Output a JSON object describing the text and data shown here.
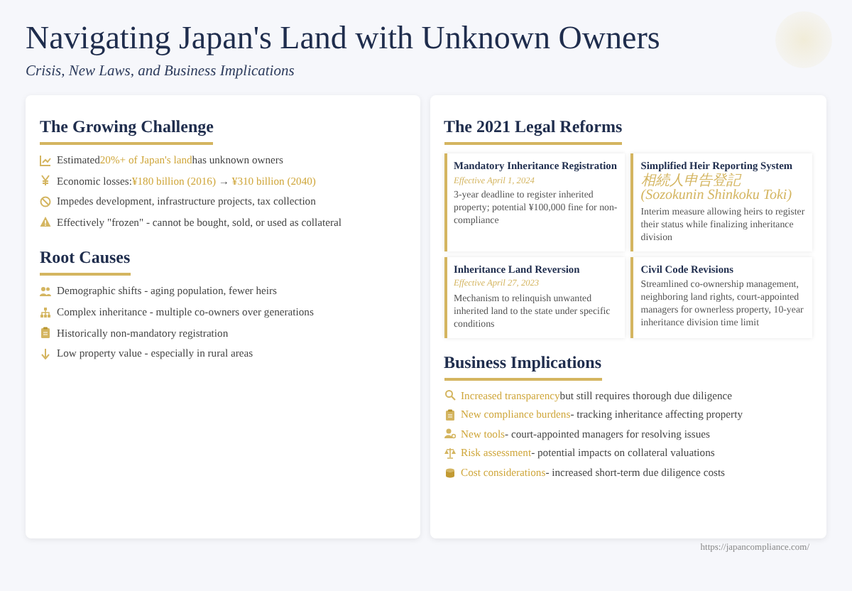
{
  "title": "Navigating Japan's Land with Unknown Owners",
  "subtitle": "Crisis, New Laws, and Business Implications",
  "left_panel": {
    "sections": [
      {
        "heading": "The Growing Challenge",
        "items": [
          {
            "segments": [
              {
                "kind": "plain",
                "text": "Estimated"
              },
              {
                "kind": "highlight",
                "text": "20%+ of Japan's land"
              },
              {
                "kind": "plain",
                "text": "has unknown owners"
              }
            ]
          },
          {
            "segments": [
              {
                "kind": "plain",
                "text": "Economic losses:"
              },
              {
                "kind": "highlight",
                "text": "¥180 billion (2016)"
              },
              {
                "kind": "plain",
                "text": " → "
              },
              {
                "kind": "highlight",
                "text": "¥310 billion (2040)"
              }
            ]
          },
          {
            "segments": [
              {
                "kind": "plain",
                "text": "Impedes development, infrastructure projects, tax collection"
              }
            ]
          },
          {
            "segments": [
              {
                "kind": "plain",
                "text": "Effectively \"frozen\" - cannot be bought, sold, or used as collateral"
              }
            ]
          }
        ]
      },
      {
        "heading": "Root Causes",
        "items": [
          {
            "segments": [
              {
                "kind": "plain",
                "text": "Demographic shifts - aging population, fewer heirs"
              }
            ]
          },
          {
            "segments": [
              {
                "kind": "plain",
                "text": "Complex inheritance - multiple co-owners over generations"
              }
            ]
          },
          {
            "segments": [
              {
                "kind": "plain",
                "text": "Historically non-mandatory registration"
              }
            ]
          },
          {
            "segments": [
              {
                "kind": "plain",
                "text": "Low property value - especially in rural areas"
              }
            ]
          }
        ]
      }
    ]
  },
  "right_panel": {
    "reforms_heading": "The 2021 Legal Reforms",
    "reforms": [
      {
        "title": "Mandatory Inheritance Registration",
        "note": "Effective April 1, 2024",
        "body": "3-year deadline to register inherited property; potential ¥100,000 fine for non-compliance"
      },
      {
        "title": "Simplified Heir Reporting System",
        "note": "相続人申告登記 (Sozokunin Shinkoku Toki)",
        "body": "Interim measure allowing heirs to register their status while finalizing inheritance division"
      },
      {
        "title": "Inheritance Land Reversion",
        "note": "Effective April 27, 2023",
        "body": "Mechanism to relinquish unwanted inherited land to the state under specific conditions"
      },
      {
        "title": "Civil Code Revisions",
        "body": "Streamlined co-ownership management, neighboring land rights, court-appointed managers for ownerless property, 10-year inheritance division time limit"
      }
    ],
    "business_heading": "Business Implications",
    "implications": [
      {
        "highlight": "Increased transparency",
        "text": "but still requires thorough due diligence"
      },
      {
        "highlight": "New compliance burdens",
        "text": "- tracking inheritance affecting property"
      },
      {
        "highlight": "New tools",
        "text": "- court-appointed managers for resolving issues"
      },
      {
        "highlight": "Risk assessment",
        "text": "- potential impacts on collateral valuations"
      },
      {
        "highlight": "Cost considerations",
        "text": "- increased short-term due diligence costs"
      }
    ]
  },
  "footer_url": "https://japancompliance.com/"
}
